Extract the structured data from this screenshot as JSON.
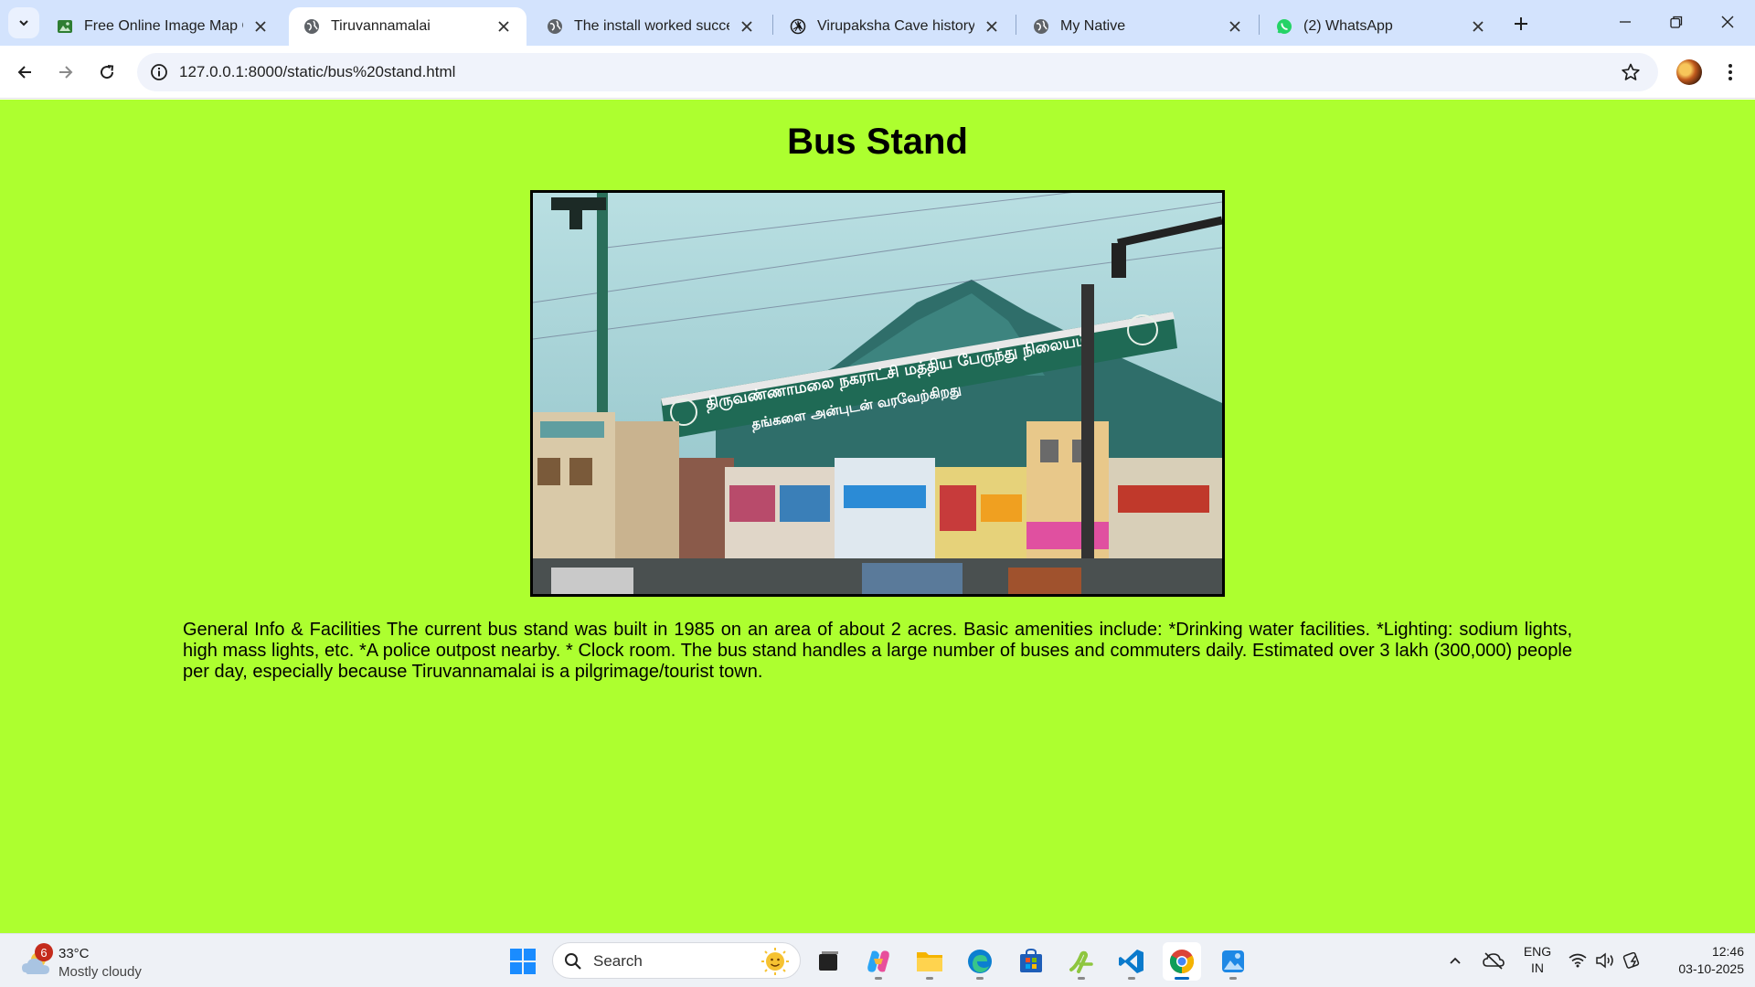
{
  "browser": {
    "tabs": [
      {
        "title": "Free Online Image Map Ge",
        "icon": "image-map-favicon-icon",
        "active": false
      },
      {
        "title": "Tiruvannamalai",
        "icon": "globe-icon",
        "active": true
      },
      {
        "title": "The install worked successf",
        "icon": "globe-icon",
        "active": false
      },
      {
        "title": "Virupaksha Cave history",
        "icon": "chatgpt-icon",
        "active": false
      },
      {
        "title": "My Native",
        "icon": "globe-icon",
        "active": false
      },
      {
        "title": "(2) WhatsApp",
        "icon": "whatsapp-icon",
        "active": false
      }
    ],
    "url": "127.0.0.1:8000/static/bus%20stand.html",
    "accent": "#d3e3fd"
  },
  "page": {
    "title": "Bus Stand",
    "background": "#adff2f",
    "image_alt": "Tiruvannamalai bus stand arch",
    "arch_sign_line1": "திருவண்ணாமலை நகராட்சி மத்திய பேருந்து நிலையம்",
    "arch_sign_line2": "தங்களை அன்புடன் வரவேற்கிறது",
    "description": "General Info & Facilities The current bus stand was built in 1985 on an area of about 2 acres. Basic amenities include: *Drinking water facilities. *Lighting: sodium lights, high mass lights, etc. *A police outpost nearby. * Clock room. The bus stand handles a large number of buses and commuters daily. Estimated over 3 lakh (300,000) people per day, especially because Tiruvannamalai is a pilgrimage/tourist town."
  },
  "taskbar": {
    "weather": {
      "badge": "6",
      "temp": "33°C",
      "condition": "Mostly cloudy"
    },
    "search_label": "Search",
    "language": {
      "line1": "ENG",
      "line2": "IN"
    },
    "clock": {
      "time": "12:46",
      "date": "03-10-2025"
    },
    "pinned": [
      "task-view-icon",
      "copilot-icon",
      "file-explorer-icon",
      "edge-icon",
      "microsoft-store-icon",
      "android-studio-icon",
      "vscode-icon",
      "chrome-icon",
      "photos-icon"
    ]
  }
}
